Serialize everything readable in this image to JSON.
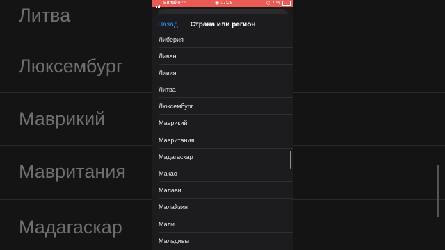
{
  "status_bar": {
    "carrier": "Билайн",
    "time": "17:28",
    "battery": "7 %"
  },
  "nav": {
    "back_label": "Назад",
    "title": "Страна или регион"
  },
  "list_items": [
    "Либерия",
    "Ливан",
    "Ливия",
    "Литва",
    "Люксембург",
    "Маврикий",
    "Мавритания",
    "Мадагаскар",
    "Макао",
    "Малави",
    "Малайзия",
    "Мали",
    "Мальдивы"
  ],
  "background_items": [
    "Литва",
    "Люксембург",
    "Маврикий",
    "Мавритания",
    "Мадагаскар"
  ],
  "colors": {
    "status_bar": "#e95b54",
    "accent": "#2f8cf5",
    "sheet": "#1c1c1e"
  }
}
